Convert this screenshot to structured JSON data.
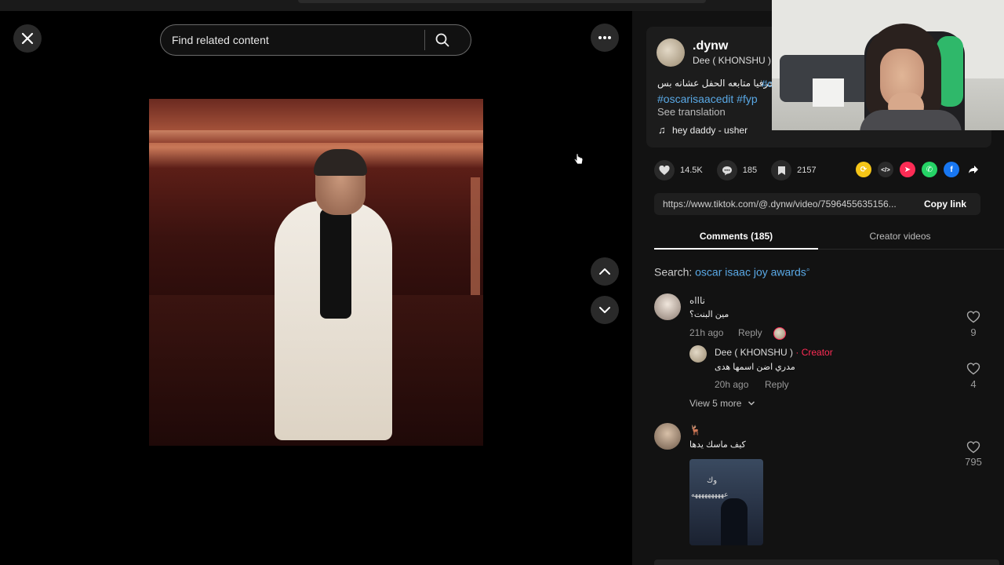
{
  "player": {
    "search_placeholder": "Find related content"
  },
  "post": {
    "username": ".dynw",
    "nickname": "Dee ( KHONSHU )",
    "description_arabic": "حرفيا متابعه الحفل عشانه بس",
    "description_hashtag_partial": "#o",
    "description_hashtags": "#oscarisaacedit #fyp",
    "see_translation": "See translation",
    "music_icon": "♫",
    "music": "hey daddy - usher"
  },
  "actions": {
    "likes": "14.5K",
    "comments": "185",
    "saves": "2157"
  },
  "share": {
    "icons": [
      {
        "name": "repost-icon",
        "color": "#f5c518",
        "glyph": "⟳"
      },
      {
        "name": "embed-icon",
        "color": "#2a2a2a",
        "glyph": "</>"
      },
      {
        "name": "send-icon",
        "color": "#fe2c55",
        "glyph": "➤"
      },
      {
        "name": "whatsapp-icon",
        "color": "#25d366",
        "glyph": "✆"
      },
      {
        "name": "facebook-icon",
        "color": "#1877f2",
        "glyph": "f"
      }
    ],
    "link": "https://www.tiktok.com/@.dynw/video/7596455635156...",
    "copy_label": "Copy link"
  },
  "tabs": {
    "comments": "Comments (185)",
    "creator": "Creator videos"
  },
  "search_suggest": {
    "prefix": "Search: ",
    "keyword": "oscar isaac joy awards",
    "icon": "⌕"
  },
  "comments": [
    {
      "name": "ناااه",
      "text": "مين البنت؟",
      "time": "21h ago",
      "reply_label": "Reply",
      "likes": "9",
      "replies": [
        {
          "name": "Dee ( KHONSHU )",
          "separator": " · ",
          "badge": "Creator",
          "text": "مدري اضن اسمها هدى",
          "time": "20h ago",
          "reply_label": "Reply",
          "likes": "4"
        }
      ],
      "view_more": "View 5 more"
    },
    {
      "name": "🦌",
      "text": "كيف ماسك يدها",
      "likes": "795",
      "image_text_1": "وك",
      "image_text_2": "عهههههههههه"
    }
  ],
  "colors": {
    "link_blue": "#5aa9e6",
    "creator_red": "#fe2c55",
    "panel_bg": "#121212"
  }
}
